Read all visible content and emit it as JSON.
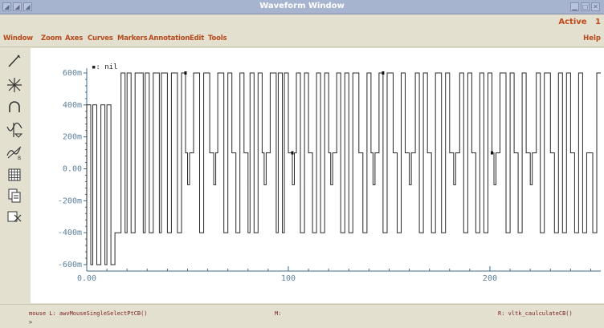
{
  "window": {
    "title": "Waveform Window",
    "status": "Active",
    "window_number": "1"
  },
  "menu": {
    "items": [
      "Window",
      "Zoom",
      "Axes",
      "Curves",
      "Markers",
      "Annotation",
      "Edit",
      "Tools"
    ],
    "help": "Help"
  },
  "toolbar": {
    "icons": [
      "pencil-icon",
      "crosshair-icon",
      "arc-icon",
      "waveform-marker-icon",
      "waveform-b-icon",
      "grid-icon",
      "copy-icon",
      "transform-icon"
    ]
  },
  "plot": {
    "trace_label": "nil"
  },
  "status": {
    "mouse_left": "mouse L: awvMouseSingleSelectPtCB()",
    "mouse_middle": "M:",
    "mouse_right": "R: vltk_caulculateCB()",
    "prompt": ">"
  },
  "chart_data": {
    "type": "line",
    "title": "",
    "xlabel": "",
    "ylabel": "",
    "xlim": [
      0,
      255
    ],
    "ylim": [
      -0.6,
      0.6
    ],
    "xticks": [
      0,
      100,
      200
    ],
    "xtick_labels": [
      "0.00",
      "100",
      "200"
    ],
    "yticks": [
      0.6,
      0.4,
      0.2,
      0.0,
      -0.2,
      -0.4,
      -0.6
    ],
    "ytick_labels": [
      "600m",
      "400m",
      "200m",
      "0.00",
      "-200m",
      "-400m",
      "-600m"
    ],
    "grid": false,
    "series": [
      {
        "name": "",
        "color": "#2a2a2a",
        "points": [
          [
            0,
            -0.6
          ],
          [
            0,
            0.4
          ],
          [
            2,
            0.4
          ],
          [
            2,
            -0.6
          ],
          [
            3,
            -0.6
          ],
          [
            3,
            0.4
          ],
          [
            5,
            0.4
          ],
          [
            5,
            -0.6
          ],
          [
            7,
            -0.6
          ],
          [
            7,
            0.4
          ],
          [
            9,
            0.4
          ],
          [
            9,
            -0.6
          ],
          [
            10,
            -0.6
          ],
          [
            10,
            0.4
          ],
          [
            12,
            0.4
          ],
          [
            12,
            -0.6
          ],
          [
            14,
            -0.6
          ],
          [
            14,
            -0.4
          ],
          [
            17,
            -0.4
          ],
          [
            17,
            0.6
          ],
          [
            19,
            0.6
          ],
          [
            19,
            -0.4
          ],
          [
            20,
            -0.4
          ],
          [
            20,
            0.6
          ],
          [
            22,
            0.6
          ],
          [
            22,
            -0.4
          ],
          [
            24,
            -0.4
          ],
          [
            24,
            0.6
          ],
          [
            28,
            0.6
          ],
          [
            28,
            -0.4
          ],
          [
            29,
            -0.4
          ],
          [
            29,
            0.6
          ],
          [
            31,
            0.6
          ],
          [
            31,
            -0.4
          ],
          [
            33,
            -0.4
          ],
          [
            33,
            0.6
          ],
          [
            36,
            0.6
          ],
          [
            36,
            -0.4
          ],
          [
            37,
            -0.4
          ],
          [
            37,
            0.6
          ],
          [
            40,
            0.6
          ],
          [
            40,
            -0.4
          ],
          [
            42,
            -0.4
          ],
          [
            42,
            0.6
          ],
          [
            45,
            0.6
          ],
          [
            45,
            -0.4
          ],
          [
            47,
            -0.4
          ],
          [
            47,
            0.6
          ],
          [
            49,
            0.6
          ],
          [
            49,
            0.1
          ],
          [
            50,
            0.1
          ],
          [
            50,
            -0.1
          ],
          [
            51,
            -0.1
          ],
          [
            51,
            0.1
          ],
          [
            53,
            0.1
          ],
          [
            53,
            0.6
          ],
          [
            56,
            0.6
          ],
          [
            56,
            -0.4
          ],
          [
            58,
            -0.4
          ],
          [
            58,
            0.6
          ],
          [
            61,
            0.6
          ],
          [
            61,
            0.1
          ],
          [
            63,
            0.1
          ],
          [
            63,
            -0.1
          ],
          [
            64,
            -0.1
          ],
          [
            64,
            0.1
          ],
          [
            65,
            0.1
          ],
          [
            65,
            0.6
          ],
          [
            68,
            0.6
          ],
          [
            68,
            -0.4
          ],
          [
            70,
            -0.4
          ],
          [
            70,
            0.6
          ],
          [
            72,
            0.6
          ],
          [
            72,
            0.1
          ],
          [
            74,
            0.1
          ],
          [
            74,
            -0.4
          ],
          [
            76,
            -0.4
          ],
          [
            76,
            0.6
          ],
          [
            78,
            0.6
          ],
          [
            78,
            0.1
          ],
          [
            80,
            0.1
          ],
          [
            80,
            -0.4
          ],
          [
            81,
            -0.4
          ],
          [
            81,
            0.6
          ],
          [
            83,
            0.6
          ],
          [
            83,
            -0.4
          ],
          [
            85,
            -0.4
          ],
          [
            85,
            0.6
          ],
          [
            87,
            0.6
          ],
          [
            87,
            0.1
          ],
          [
            88,
            0.1
          ],
          [
            88,
            -0.1
          ],
          [
            89,
            -0.1
          ],
          [
            89,
            0.1
          ],
          [
            91,
            0.1
          ],
          [
            91,
            0.6
          ],
          [
            94,
            0.6
          ],
          [
            94,
            -0.4
          ],
          [
            95,
            -0.4
          ],
          [
            95,
            0.6
          ],
          [
            97,
            0.6
          ],
          [
            97,
            -0.4
          ],
          [
            98,
            -0.4
          ],
          [
            98,
            0.6
          ],
          [
            100,
            0.6
          ],
          [
            100,
            0.1
          ],
          [
            102,
            0.1
          ],
          [
            102,
            -0.1
          ],
          [
            103,
            -0.1
          ],
          [
            103,
            0.1
          ],
          [
            104,
            0.1
          ],
          [
            104,
            0.6
          ],
          [
            106,
            0.6
          ],
          [
            106,
            -0.4
          ],
          [
            108,
            -0.4
          ],
          [
            108,
            0.6
          ],
          [
            110,
            0.6
          ],
          [
            110,
            0.1
          ],
          [
            112,
            0.1
          ],
          [
            112,
            -0.4
          ],
          [
            114,
            -0.4
          ],
          [
            114,
            0.6
          ],
          [
            116,
            0.6
          ],
          [
            116,
            -0.4
          ],
          [
            118,
            -0.4
          ],
          [
            118,
            0.6
          ],
          [
            120,
            0.6
          ],
          [
            120,
            0.1
          ],
          [
            121,
            0.1
          ],
          [
            121,
            -0.1
          ],
          [
            122,
            -0.1
          ],
          [
            122,
            0.1
          ],
          [
            124,
            0.1
          ],
          [
            124,
            0.6
          ],
          [
            126,
            0.6
          ],
          [
            126,
            -0.4
          ],
          [
            128,
            -0.4
          ],
          [
            128,
            0.6
          ],
          [
            130,
            0.6
          ],
          [
            130,
            -0.4
          ],
          [
            132,
            -0.4
          ],
          [
            132,
            0.6
          ],
          [
            135,
            0.6
          ],
          [
            135,
            0.1
          ],
          [
            137,
            0.1
          ],
          [
            137,
            -0.4
          ],
          [
            139,
            -0.4
          ],
          [
            139,
            0.6
          ],
          [
            141,
            0.6
          ],
          [
            141,
            0.1
          ],
          [
            142,
            0.1
          ],
          [
            142,
            -0.1
          ],
          [
            143,
            -0.1
          ],
          [
            143,
            0.1
          ],
          [
            145,
            0.1
          ],
          [
            145,
            0.6
          ],
          [
            147,
            0.6
          ],
          [
            147,
            -0.4
          ],
          [
            149,
            -0.4
          ],
          [
            149,
            0.6
          ],
          [
            152,
            0.6
          ],
          [
            152,
            0.1
          ],
          [
            154,
            0.1
          ],
          [
            154,
            -0.4
          ],
          [
            156,
            -0.4
          ],
          [
            156,
            0.6
          ],
          [
            158,
            0.6
          ],
          [
            158,
            0.1
          ],
          [
            160,
            0.1
          ],
          [
            160,
            -0.1
          ],
          [
            161,
            -0.1
          ],
          [
            161,
            0.1
          ],
          [
            163,
            0.1
          ],
          [
            163,
            0.6
          ],
          [
            165,
            0.6
          ],
          [
            165,
            -0.4
          ],
          [
            167,
            -0.4
          ],
          [
            167,
            0.6
          ],
          [
            169,
            0.6
          ],
          [
            169,
            0.1
          ],
          [
            171,
            0.1
          ],
          [
            171,
            -0.4
          ],
          [
            173,
            -0.4
          ],
          [
            173,
            0.6
          ],
          [
            176,
            0.6
          ],
          [
            176,
            -0.4
          ],
          [
            178,
            -0.4
          ],
          [
            178,
            0.6
          ],
          [
            180,
            0.6
          ],
          [
            180,
            0.1
          ],
          [
            182,
            0.1
          ],
          [
            182,
            -0.1
          ],
          [
            183,
            -0.1
          ],
          [
            183,
            0.1
          ],
          [
            185,
            0.1
          ],
          [
            185,
            0.6
          ],
          [
            187,
            0.6
          ],
          [
            187,
            -0.4
          ],
          [
            189,
            -0.4
          ],
          [
            189,
            0.6
          ],
          [
            191,
            0.6
          ],
          [
            191,
            0.1
          ],
          [
            193,
            0.1
          ],
          [
            193,
            -0.4
          ],
          [
            195,
            -0.4
          ],
          [
            195,
            0.6
          ],
          [
            197,
            0.6
          ],
          [
            197,
            -0.4
          ],
          [
            199,
            -0.4
          ],
          [
            199,
            0.6
          ],
          [
            201,
            0.6
          ],
          [
            201,
            0.1
          ],
          [
            202,
            0.1
          ],
          [
            202,
            -0.1
          ],
          [
            203,
            -0.1
          ],
          [
            203,
            0.1
          ],
          [
            205,
            0.1
          ],
          [
            205,
            0.6
          ],
          [
            208,
            0.6
          ],
          [
            208,
            -0.4
          ],
          [
            210,
            -0.4
          ],
          [
            210,
            0.6
          ],
          [
            212,
            0.6
          ],
          [
            212,
            0.1
          ],
          [
            214,
            0.1
          ],
          [
            214,
            -0.4
          ],
          [
            216,
            -0.4
          ],
          [
            216,
            0.6
          ],
          [
            218,
            0.6
          ],
          [
            218,
            0.1
          ],
          [
            220,
            0.1
          ],
          [
            220,
            -0.1
          ],
          [
            221,
            -0.1
          ],
          [
            221,
            0.1
          ],
          [
            223,
            0.1
          ],
          [
            223,
            0.6
          ],
          [
            225,
            0.6
          ],
          [
            225,
            -0.4
          ],
          [
            227,
            -0.4
          ],
          [
            227,
            0.6
          ],
          [
            230,
            0.6
          ],
          [
            230,
            0.1
          ],
          [
            232,
            0.1
          ],
          [
            232,
            -0.4
          ],
          [
            234,
            -0.4
          ],
          [
            234,
            0.6
          ],
          [
            236,
            0.6
          ],
          [
            236,
            -0.4
          ],
          [
            238,
            -0.4
          ],
          [
            238,
            0.6
          ],
          [
            240,
            0.6
          ],
          [
            240,
            0.1
          ],
          [
            242,
            0.1
          ],
          [
            242,
            -0.4
          ],
          [
            244,
            -0.4
          ],
          [
            244,
            0.6
          ],
          [
            246,
            0.6
          ],
          [
            246,
            -0.4
          ],
          [
            248,
            -0.4
          ],
          [
            248,
            0.1
          ],
          [
            251,
            0.1
          ],
          [
            251,
            -0.4
          ],
          [
            253,
            -0.4
          ],
          [
            253,
            0.6
          ],
          [
            255,
            0.6
          ]
        ]
      }
    ],
    "markers": [
      {
        "x": 49,
        "y": 0.6
      },
      {
        "x": 102,
        "y": 0.1
      },
      {
        "x": 147,
        "y": 0.6
      },
      {
        "x": 201,
        "y": 0.1
      }
    ]
  }
}
